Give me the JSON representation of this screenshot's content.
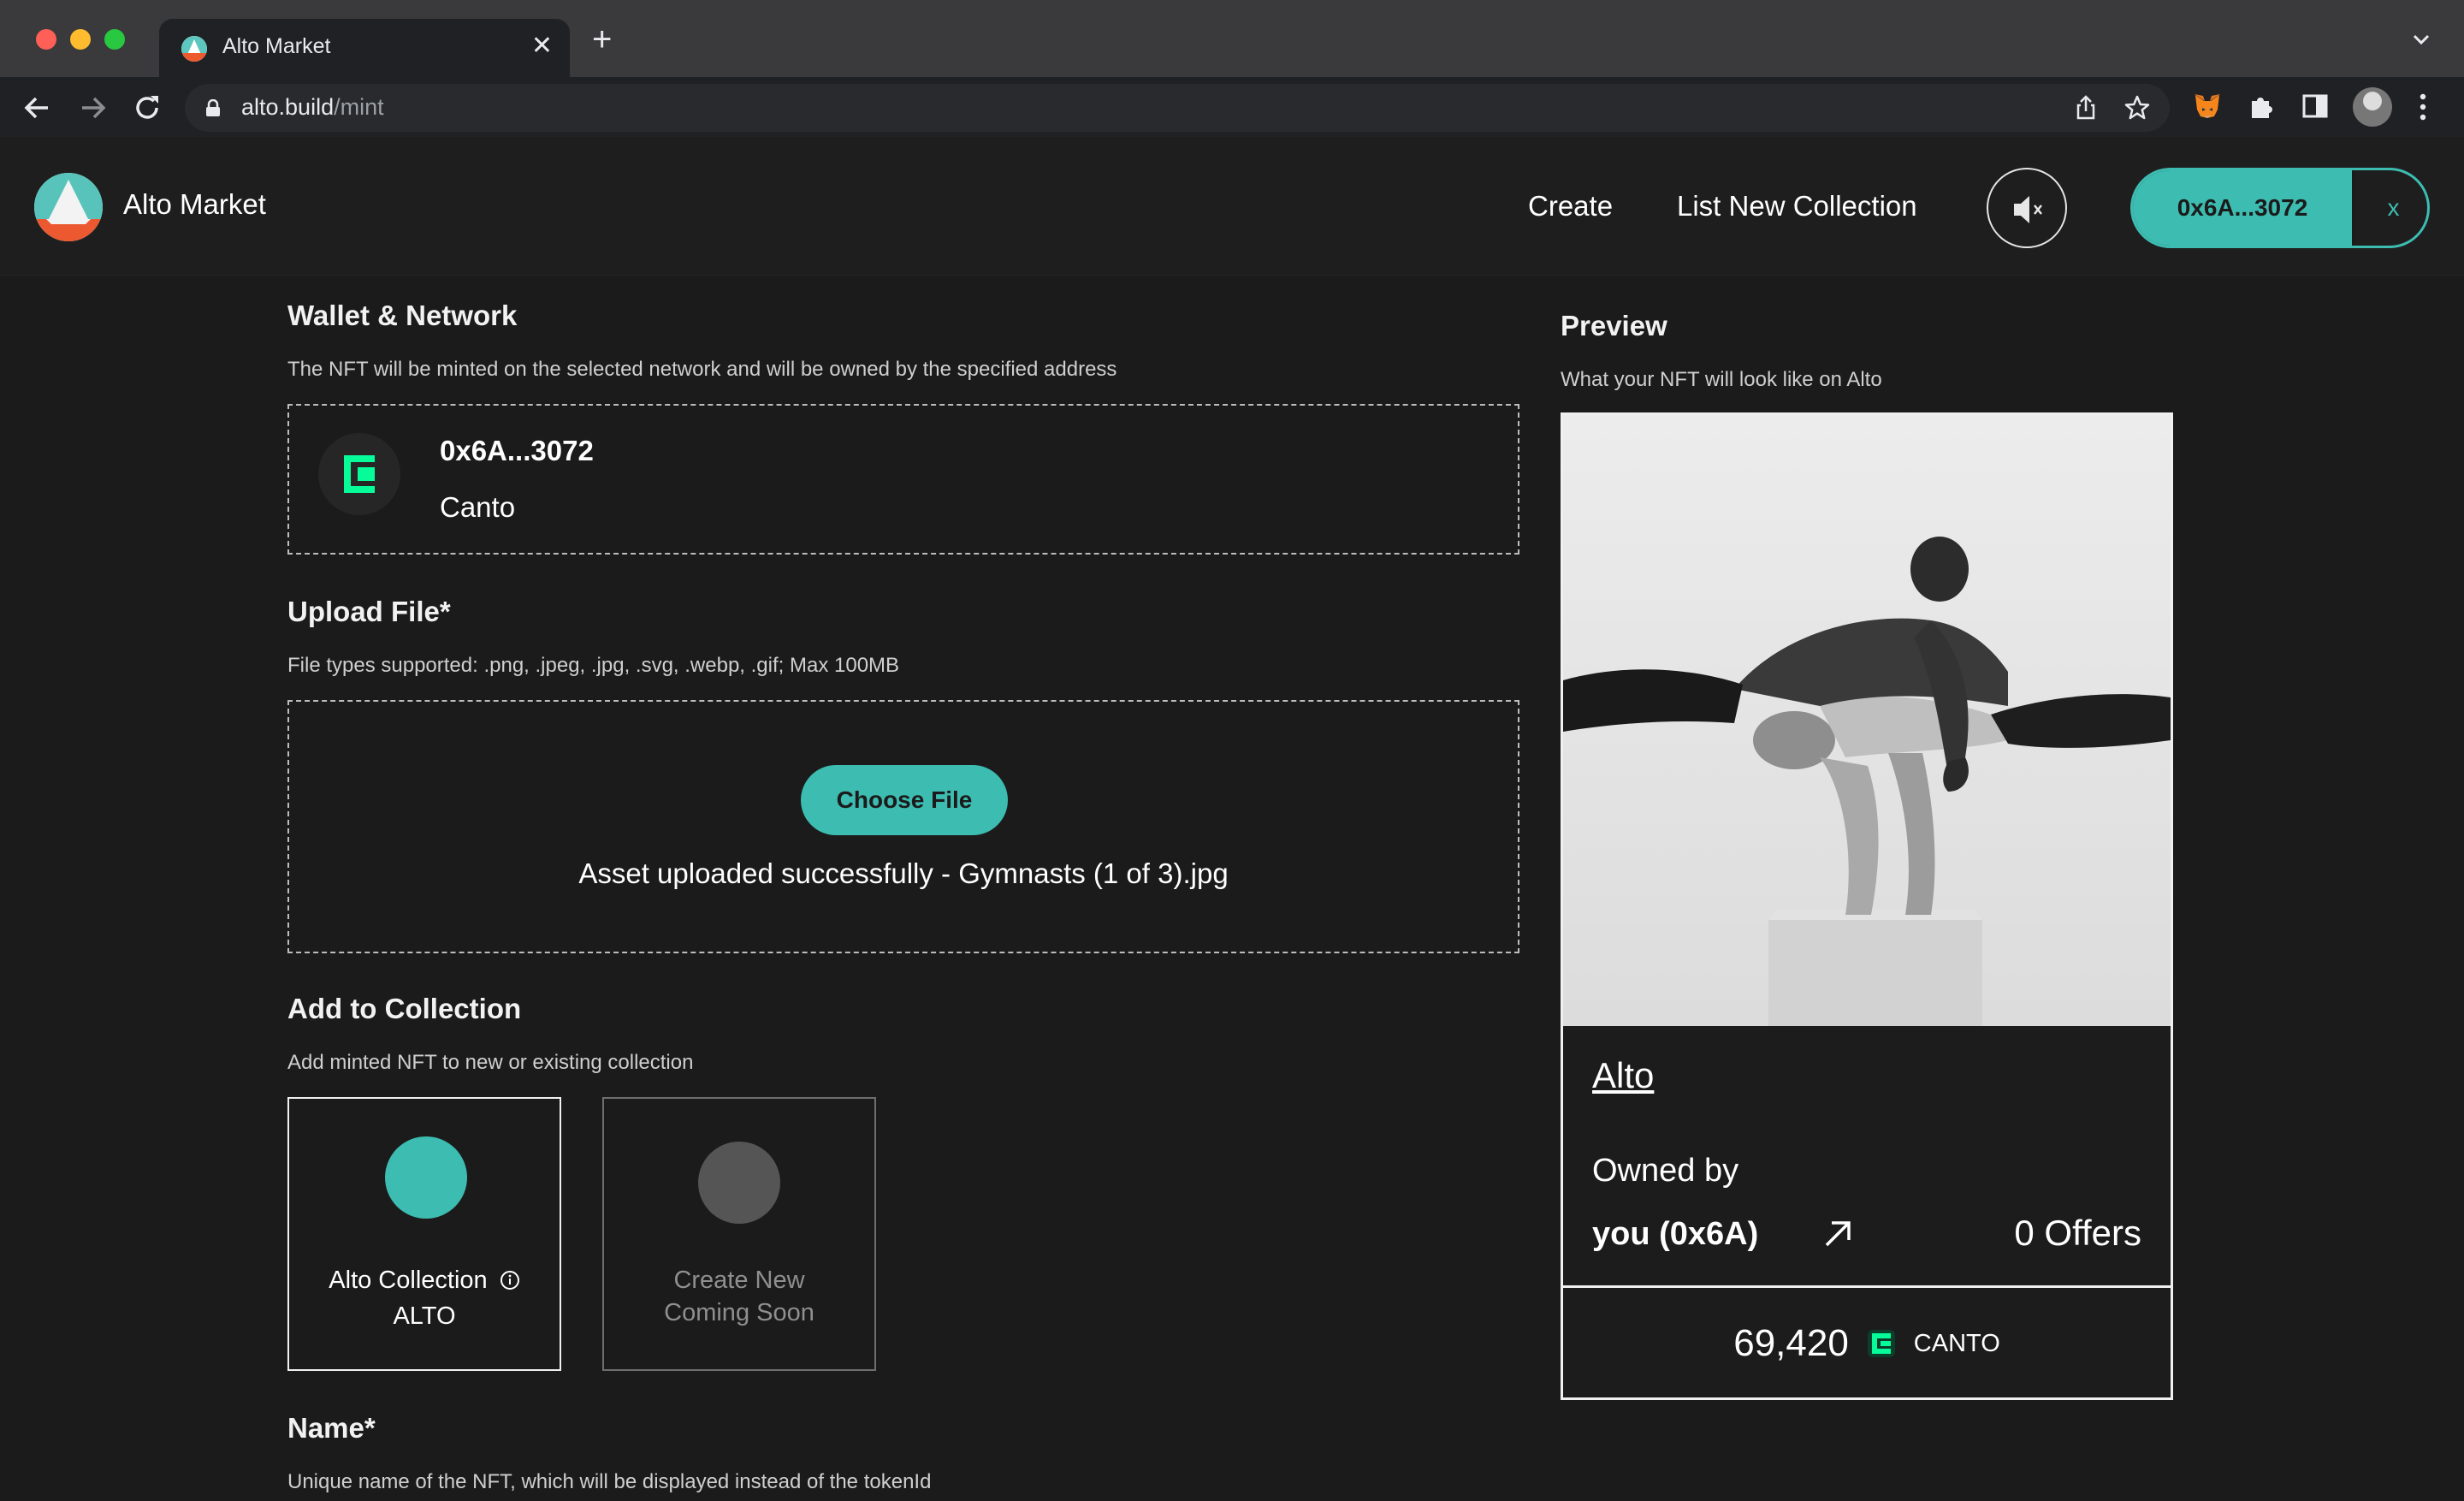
{
  "browser": {
    "tab_title": "Alto Market",
    "tab_close": "✕",
    "new_tab": "+",
    "url_host": "alto.build",
    "url_path": "/mint"
  },
  "header": {
    "brand": "Alto Market",
    "nav": [
      "Create",
      "List New Collection"
    ],
    "wallet_address": "0x6A...3072",
    "disconnect_label": "x"
  },
  "wallet_section": {
    "title": "Wallet & Network",
    "description": "The NFT will be minted on the selected network and will be owned by the specified address",
    "address": "0x6A...3072",
    "network": "Canto"
  },
  "upload_section": {
    "title": "Upload File*",
    "description": "File types supported: .png, .jpeg, .jpg, .svg, .webp, .gif; Max 100MB",
    "button_label": "Choose File",
    "status": "Asset uploaded successfully - Gymnasts (1 of 3).jpg"
  },
  "collection_section": {
    "title": "Add to Collection",
    "description": "Add minted NFT to new or existing collection",
    "cards": [
      {
        "name": "Alto Collection",
        "symbol": "ALTO",
        "info_icon": "info-icon",
        "color": "#3dbcb1"
      },
      {
        "name": "Create New",
        "subtitle": "Coming Soon",
        "color": "#555555"
      }
    ]
  },
  "name_section": {
    "title": "Name*",
    "description": "Unique name of the NFT, which will be displayed instead of the tokenId"
  },
  "preview": {
    "title": "Preview",
    "description": "What your NFT will look like on Alto",
    "nft_name": "Alto",
    "owned_by_label": "Owned by",
    "owner": "you (0x6A)",
    "offers": "0 Offers",
    "price": "69,420",
    "currency": "CANTO"
  },
  "colors": {
    "accent": "#3dbcb1",
    "background": "#1b1b1b",
    "canto_green": "#06fc99"
  }
}
